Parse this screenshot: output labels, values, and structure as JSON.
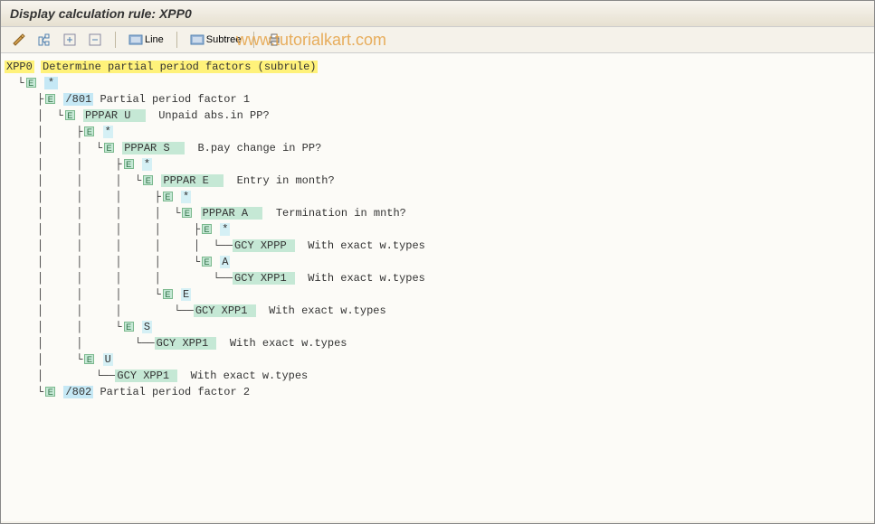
{
  "title": "Display calculation rule: XPP0",
  "toolbar": {
    "line_label": "Line",
    "subtree_label": "Subtree"
  },
  "watermark": "www.tutorialkart.com",
  "tree": {
    "root_code": "XPP0",
    "root_desc": "Determine partial period factors (subrule)",
    "n1_code": "*",
    "n2_code": "/801",
    "n2_desc": "Partial period factor 1",
    "n3_code": "PPPAR U  ",
    "n3_desc": "Unpaid abs.in PP?",
    "n4_code": "*",
    "n5_code": "PPPAR S  ",
    "n5_desc": "B.pay change in PP?",
    "n6_code": "*",
    "n7_code": "PPPAR E  ",
    "n7_desc": "Entry in month?",
    "n8_code": "*",
    "n9_code": "PPPAR A  ",
    "n9_desc": "Termination in mnth?",
    "n10_code": "*",
    "n11_code": "GCY XPPP ",
    "n11_desc": "With exact w.types",
    "n12_code": "A",
    "n13_code": "GCY XPP1 ",
    "n13_desc": "With exact w.types",
    "n14_code": "E",
    "n15_code": "GCY XPP1 ",
    "n15_desc": "With exact w.types",
    "n16_code": "S",
    "n17_code": "GCY XPP1 ",
    "n17_desc": "With exact w.types",
    "n18_code": "U",
    "n19_code": "GCY XPP1 ",
    "n19_desc": "With exact w.types",
    "n20_code": "/802",
    "n20_desc": "Partial period factor 2"
  }
}
